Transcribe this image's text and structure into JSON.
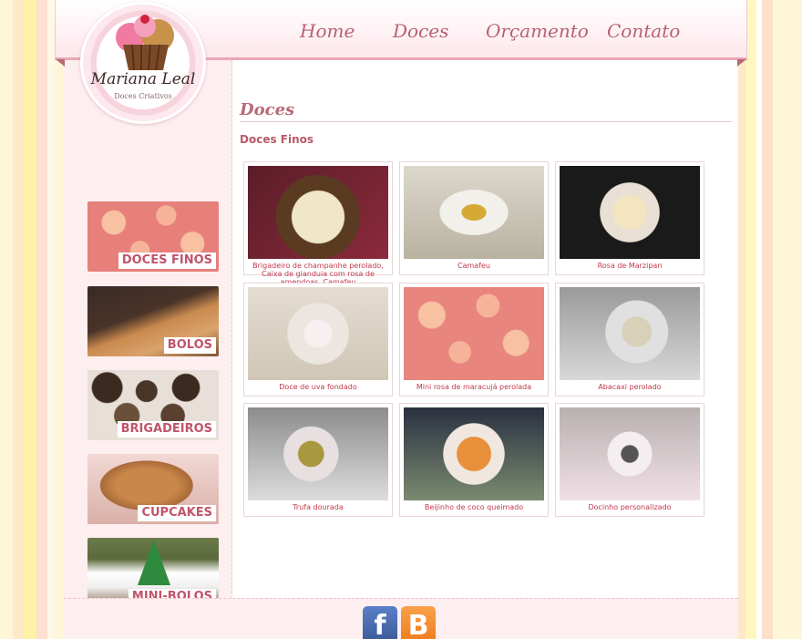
{
  "brand": {
    "name": "Mariana Leal",
    "tagline": "Doces Criativos"
  },
  "nav": [
    {
      "label": "Home"
    },
    {
      "label": "Doces"
    },
    {
      "label": "Orçamento"
    },
    {
      "label": "Contato"
    }
  ],
  "sidebar": {
    "categories": [
      {
        "label": "DOCES FINOS"
      },
      {
        "label": "BOLOS"
      },
      {
        "label": "BRIGADEIROS"
      },
      {
        "label": "CUPCAKES"
      },
      {
        "label": "MINI-BOLOS"
      }
    ]
  },
  "main": {
    "title": "Doces",
    "subtitle": "Doces Finos",
    "gallery": [
      {
        "caption": "Brigadeiro de champanhe perolado, Caixa de gianduia com rosa de amendoas, Camafeu"
      },
      {
        "caption": "Camafeu"
      },
      {
        "caption": "Rosa de Marzipan"
      },
      {
        "caption": "Doce de uva fondado"
      },
      {
        "caption": "Mini rosa de maracujá perolada"
      },
      {
        "caption": "Abacaxi perolado"
      },
      {
        "caption": "Trufa dourada"
      },
      {
        "caption": "Beijinho de coco queimado"
      },
      {
        "caption": "Docinho personalizado"
      }
    ]
  },
  "footer": {
    "social": [
      {
        "icon": "facebook-icon",
        "glyph": "f"
      },
      {
        "icon": "blogger-icon",
        "glyph": "B"
      }
    ]
  },
  "colors": {
    "accent": "#c0546c",
    "nav": "#b85f73",
    "caption": "#c0394a"
  }
}
